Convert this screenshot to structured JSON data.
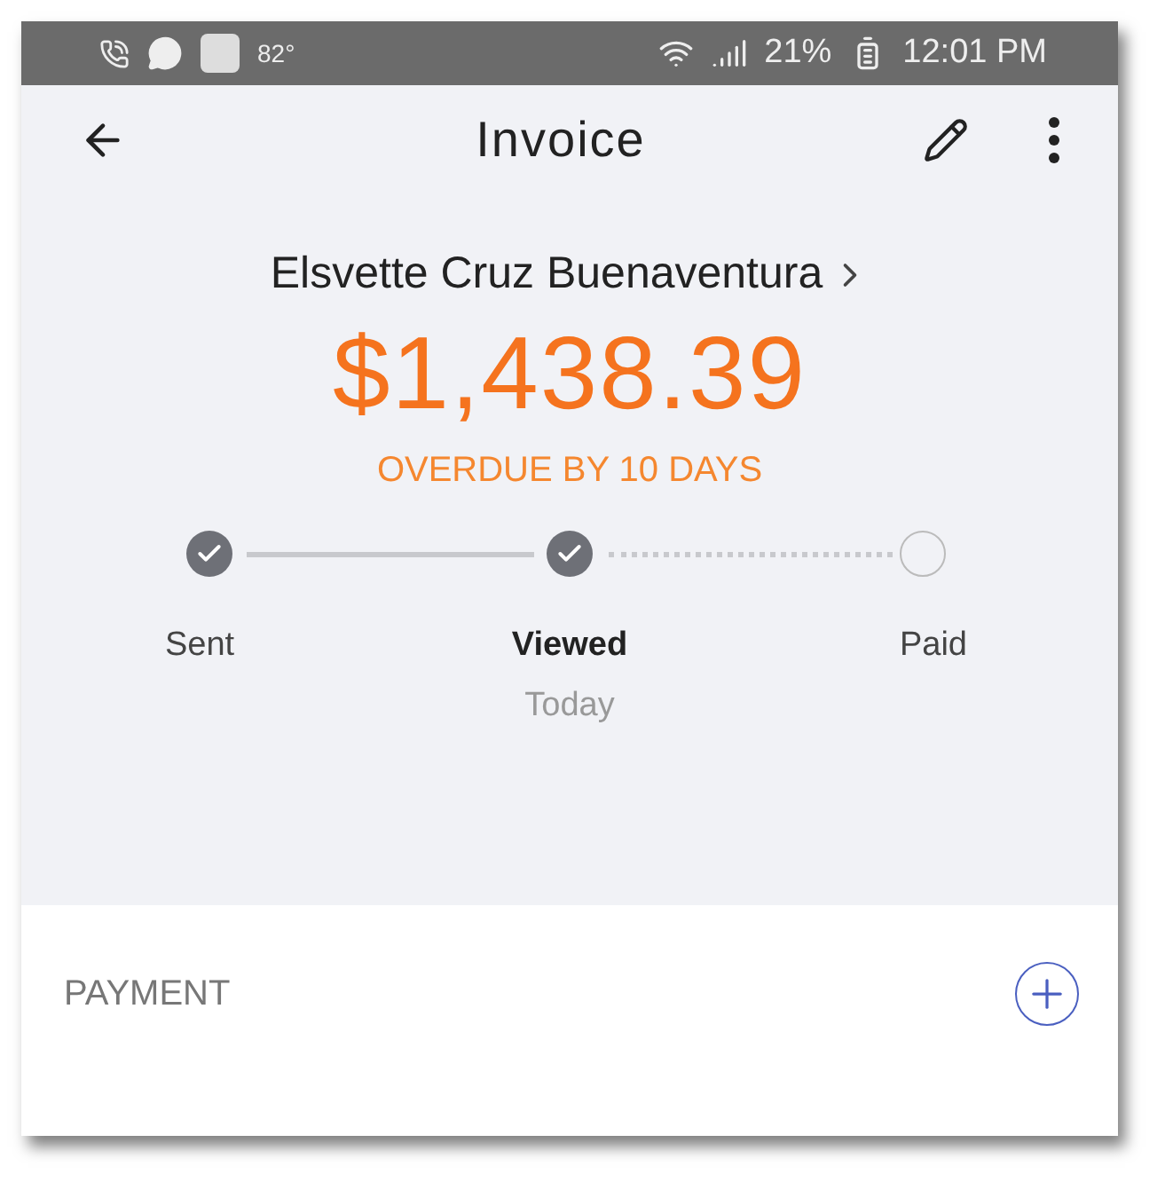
{
  "status_bar": {
    "temperature": "82°",
    "battery": "21%",
    "time": "12:01 PM"
  },
  "app_bar": {
    "title": "Invoice"
  },
  "invoice": {
    "customer": "Elsvette Cruz Buenaventura",
    "amount": "$1,438.39",
    "status": "OVERDUE BY 10 DAYS"
  },
  "progress": [
    {
      "label": "Sent",
      "done": true,
      "current": false
    },
    {
      "label": "Viewed",
      "done": true,
      "current": true,
      "sublabel": "Today"
    },
    {
      "label": "Paid",
      "done": false,
      "current": false
    }
  ],
  "payment": {
    "title": "PAYMENT"
  }
}
